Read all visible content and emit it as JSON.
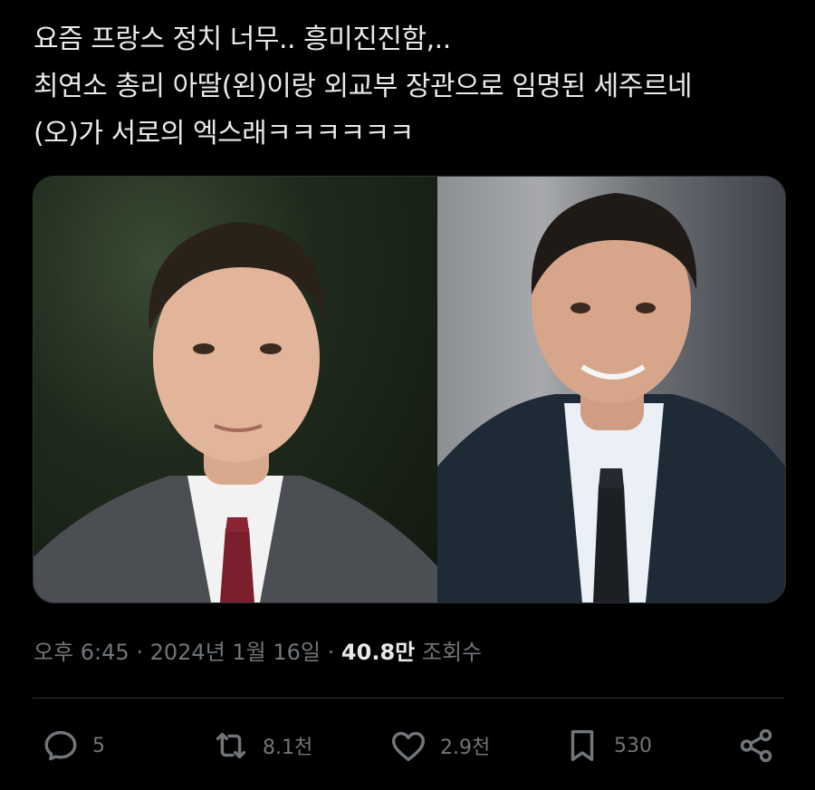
{
  "tweet": {
    "text_lines": [
      "요즘 프랑스 정치 너무.. 흥미진진함,..",
      "최연소 총리 아딸(왼)이랑 외교부 장관으로 임명된 세주르네",
      "(오)가 서로의 엑스래ㅋㅋㅋㅋㅋㅋ"
    ]
  },
  "meta": {
    "time": "오후 6:45",
    "separator": "·",
    "date": "2024년 1월 16일",
    "views_count": "40.8만",
    "views_label": "조회수"
  },
  "actions": {
    "reply": {
      "icon": "reply-icon",
      "count": "5"
    },
    "retweet": {
      "icon": "retweet-icon",
      "count": "8.1천"
    },
    "like": {
      "icon": "heart-icon",
      "count": "2.9천"
    },
    "bookmark": {
      "icon": "bookmark-icon",
      "count": "530"
    },
    "share": {
      "icon": "share-icon"
    }
  },
  "colors": {
    "background": "#000000",
    "text": "#e7e9ea",
    "secondary": "#71767b",
    "border": "#2f3336"
  }
}
